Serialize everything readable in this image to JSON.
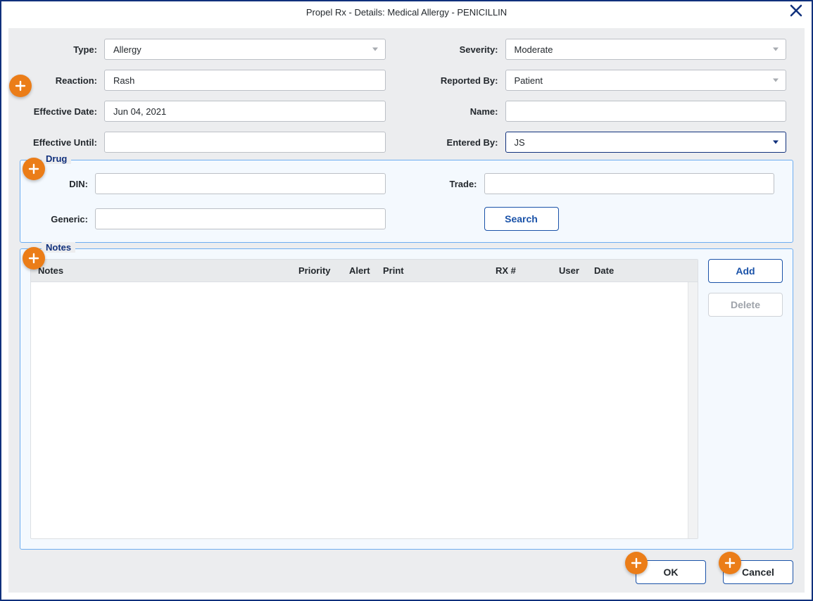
{
  "window": {
    "title": "Propel Rx - Details: Medical Allergy - PENICILLIN"
  },
  "left": {
    "type_label": "Type:",
    "type_value": "Allergy",
    "reaction_label": "Reaction:",
    "reaction_value": "Rash",
    "eff_date_label": "Effective Date:",
    "eff_date_value": "Jun 04, 2021",
    "eff_until_label": "Effective Until:",
    "eff_until_value": ""
  },
  "right": {
    "severity_label": "Severity:",
    "severity_value": "Moderate",
    "reported_by_label": "Reported By:",
    "reported_by_value": "Patient",
    "name_label": "Name:",
    "name_value": "",
    "entered_by_label": "Entered By:",
    "entered_by_value": "JS"
  },
  "drug": {
    "legend": "Drug",
    "din_label": "DIN:",
    "din_value": "",
    "trade_label": "Trade:",
    "trade_value": "",
    "generic_label": "Generic:",
    "generic_value": "",
    "search_label": "Search"
  },
  "notes": {
    "legend": "Notes",
    "cols": {
      "notes": "Notes",
      "priority": "Priority",
      "alert": "Alert",
      "print": "Print",
      "rx": "RX #",
      "user": "User",
      "date": "Date"
    },
    "add_label": "Add",
    "delete_label": "Delete"
  },
  "footer": {
    "ok_label": "OK",
    "cancel_label": "Cancel"
  }
}
